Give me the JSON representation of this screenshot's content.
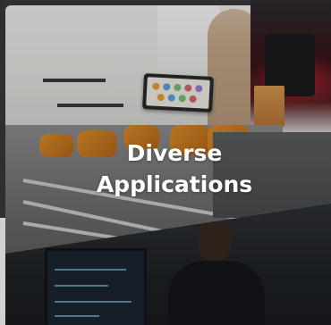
{
  "card": {
    "title_line1": "Diverse",
    "title_line2": "Applications"
  },
  "colors": {
    "title_text": "#ffffff",
    "robot_arm": "#e0902e",
    "robot_glow": "#ff283c",
    "background": "#2b2b2d"
  },
  "icons": {
    "tablet": "tablet-device",
    "robot": "robot-device",
    "monitor": "monitor-screen"
  }
}
